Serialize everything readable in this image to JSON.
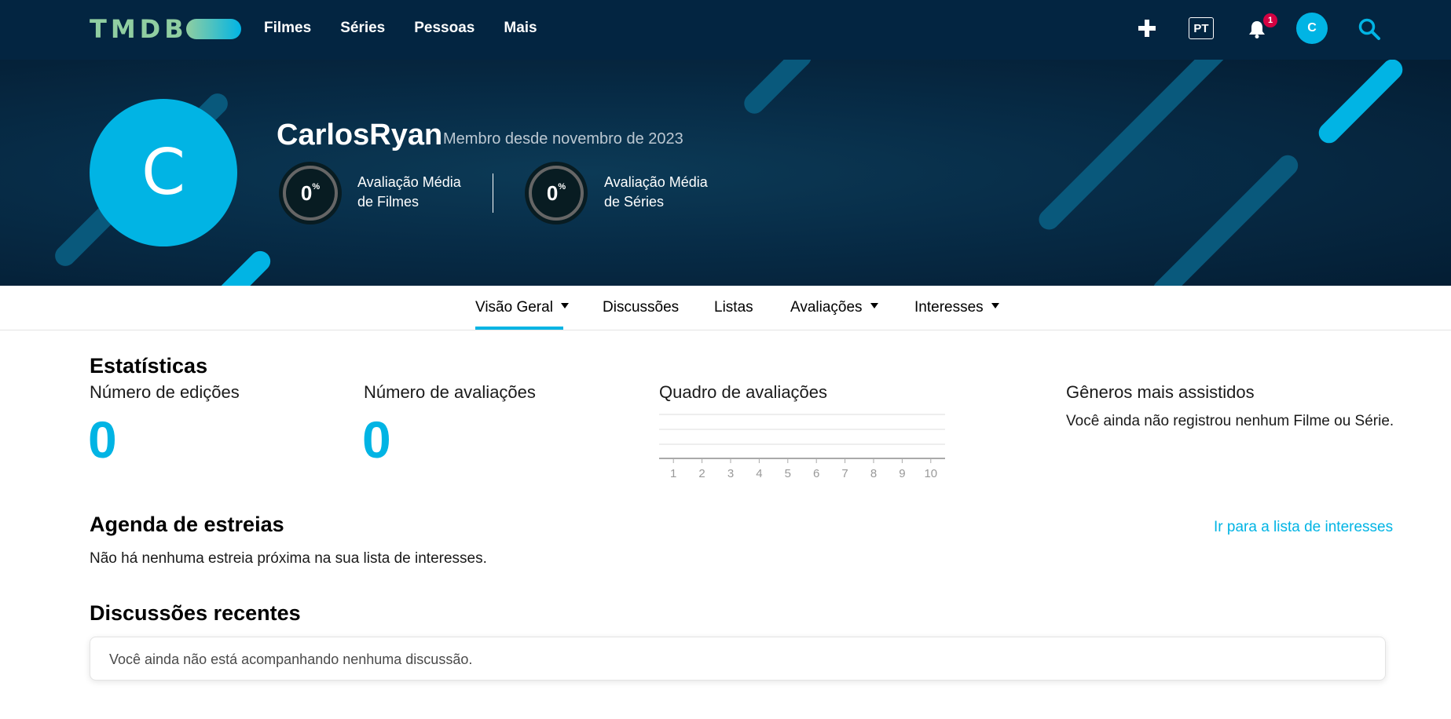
{
  "nav": {
    "logo": "TMDB",
    "links": [
      "Filmes",
      "Séries",
      "Pessoas",
      "Mais"
    ],
    "language": "PT",
    "notification_count": "1",
    "avatar_initial": "C"
  },
  "profile": {
    "avatar_initial": "C",
    "username": "CarlosRyan",
    "member_since": "Membro desde novembro de 2023",
    "movies_score": "0",
    "movies_score_unit": "%",
    "movies_label_line1": "Avaliação Média",
    "movies_label_line2": "de Filmes",
    "tv_score": "0",
    "tv_score_unit": "%",
    "tv_label_line1": "Avaliação Média",
    "tv_label_line2": "de Séries"
  },
  "tabs": [
    {
      "label": "Visão Geral",
      "dropdown": true,
      "active": true
    },
    {
      "label": "Discussões",
      "dropdown": false
    },
    {
      "label": "Listas",
      "dropdown": false
    },
    {
      "label": "Avaliações",
      "dropdown": true
    },
    {
      "label": "Interesses",
      "dropdown": true
    }
  ],
  "stats": {
    "heading": "Estatísticas",
    "edits_label": "Número de edições",
    "edits_value": "0",
    "ratings_label": "Número de avaliações",
    "ratings_value": "0",
    "chart_title": "Quadro de avaliações",
    "genres_title": "Gêneros mais assistidos",
    "genres_empty": "Você ainda não registrou nenhum Filme ou Série."
  },
  "chart_data": {
    "type": "bar",
    "categories": [
      "1",
      "2",
      "3",
      "4",
      "5",
      "6",
      "7",
      "8",
      "9",
      "10"
    ],
    "values": [
      0,
      0,
      0,
      0,
      0,
      0,
      0,
      0,
      0,
      0
    ],
    "title": "Quadro de avaliações",
    "grid": true
  },
  "upcoming": {
    "heading": "Agenda de estreias",
    "link": "Ir para a lista de interesses",
    "empty": "Não há nenhuma estreia próxima na sua lista de interesses."
  },
  "discussions": {
    "heading": "Discussões recentes",
    "empty": "Você ainda não está acompanhando nenhuma discussão."
  },
  "colors": {
    "navy": "#032541",
    "accent": "#01b4e4",
    "logo_green": "#90cea1",
    "badge_red": "#d40242"
  }
}
